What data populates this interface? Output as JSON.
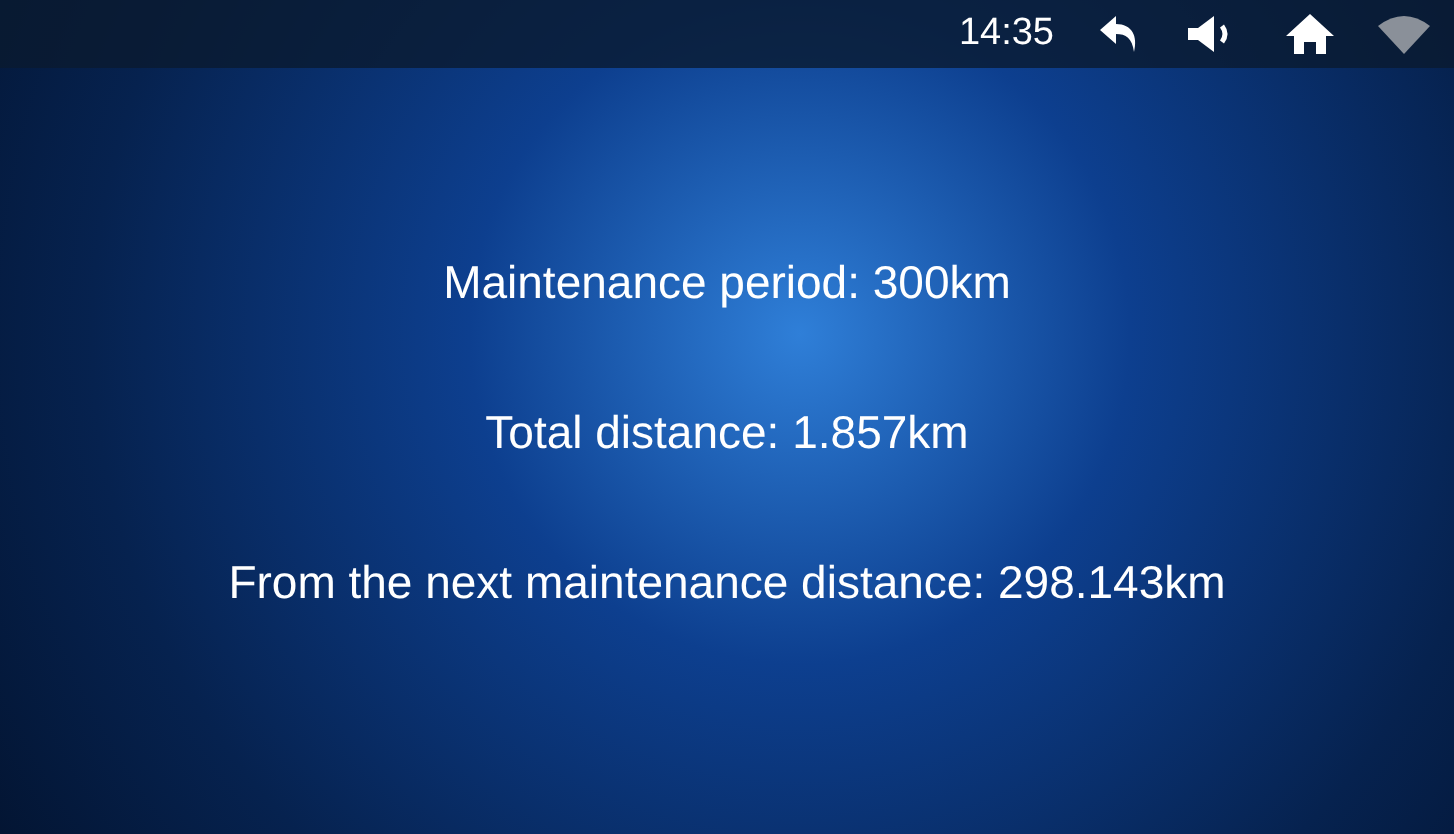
{
  "status_bar": {
    "time": "14:35"
  },
  "lines": [
    {
      "text": "Maintenance period: 300km"
    },
    {
      "text": "Total distance: 1.857km"
    },
    {
      "text": "From the next maintenance distance: 298.143km"
    }
  ]
}
